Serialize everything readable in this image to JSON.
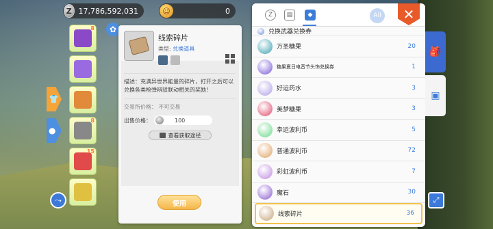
{
  "currency": {
    "zeny": {
      "icon": "Z",
      "value": "17,786,592,031"
    },
    "gem": {
      "icon": "☺",
      "value": "0"
    }
  },
  "side_items": [
    {
      "name": "purple-book",
      "badge": "8",
      "color": "#8a4ac8"
    },
    {
      "name": "purple-cloak",
      "badge": "",
      "color": "#9a6ae0"
    },
    {
      "name": "orange-bag",
      "badge": "",
      "color": "#e08a3a"
    },
    {
      "name": "boots",
      "badge": "8",
      "color": "#888888"
    },
    {
      "name": "red-ornament",
      "badge": "15",
      "color": "#e04a4a"
    },
    {
      "name": "candy-bundle",
      "badge": "",
      "color": "#e0c040"
    }
  ],
  "detail": {
    "name": "线索碎片",
    "type_label": "类型:",
    "type_value": "兑换道具",
    "description": "描述：充满异世界能量的碎片，打开之后可以兑换各类枪弹辩驳联动相关的奖励！",
    "trade": "交易所价格：  不可交易",
    "price_label": "出售价格：",
    "price_value": "100",
    "source_button": "查看获取途径",
    "use_button": "使用"
  },
  "inventory": {
    "all_label": "All",
    "close_label": "✕",
    "items": [
      {
        "name": "兑换武器兑换券",
        "count": "",
        "color": "#6a8ad8",
        "partial": true
      },
      {
        "name": "万圣糖果",
        "count": "20",
        "color": "#3aa0b0"
      },
      {
        "name": "糖果夏日电音节头饰兑换券",
        "count": "1",
        "color": "#7a5ad8",
        "small": true
      },
      {
        "name": "好运药水",
        "count": "3",
        "color": "#b0a0e8"
      },
      {
        "name": "美梦糖果",
        "count": "3",
        "color": "#e04a6a"
      },
      {
        "name": "幸运波利币",
        "count": "5",
        "color": "#6ad88a"
      },
      {
        "name": "普通波利币",
        "count": "72",
        "color": "#e0a060"
      },
      {
        "name": "彩虹波利币",
        "count": "7",
        "color": "#c08ae0"
      },
      {
        "name": "魔石",
        "count": "30",
        "color": "#8a5ad0"
      },
      {
        "name": "线索碎片",
        "count": "36",
        "color": "#c7a47a",
        "selected": true
      }
    ]
  }
}
